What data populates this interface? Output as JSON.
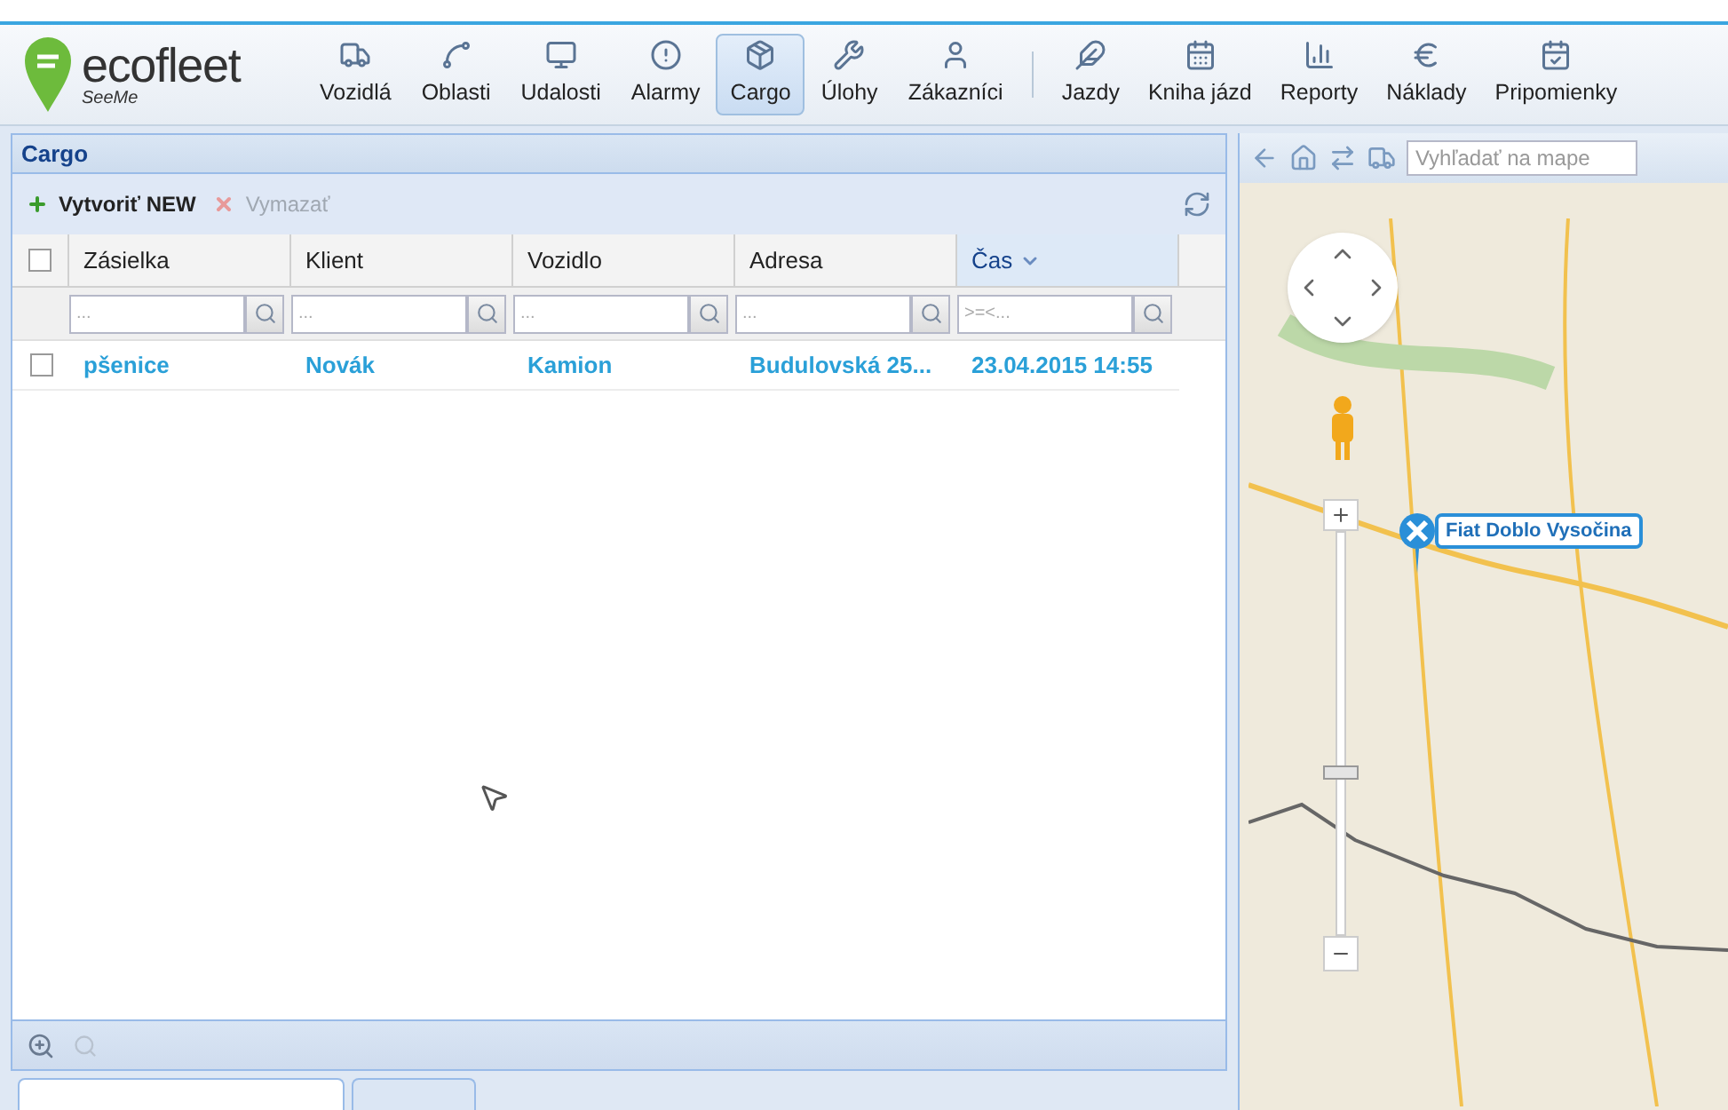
{
  "logo": {
    "name": "ecofleet",
    "subtitle": "SeeMe"
  },
  "nav_primary": [
    {
      "label": "Vozidlá",
      "selected": false
    },
    {
      "label": "Oblasti",
      "selected": false
    },
    {
      "label": "Udalosti",
      "selected": false
    },
    {
      "label": "Alarmy",
      "selected": false
    },
    {
      "label": "Cargo",
      "selected": true
    },
    {
      "label": "Úlohy",
      "selected": false
    },
    {
      "label": "Zákazníci",
      "selected": false
    }
  ],
  "nav_secondary": [
    {
      "label": "Jazdy",
      "selected": false
    },
    {
      "label": "Kniha jázd",
      "selected": false
    },
    {
      "label": "Reporty",
      "selected": false
    },
    {
      "label": "Náklady",
      "selected": false
    },
    {
      "label": "Pripomienky",
      "selected": false
    }
  ],
  "panel": {
    "title": "Cargo",
    "toolbar": [
      {
        "kind": "add",
        "label": "Vytvoriť NEW",
        "disabled": false
      },
      {
        "kind": "delete",
        "label": "Vymazať",
        "disabled": true
      }
    ],
    "table": {
      "select_all_checked": false,
      "columns": [
        {
          "label": "Zásielka",
          "sorted": false,
          "filter_placeholder": "..."
        },
        {
          "label": "Klient",
          "sorted": false,
          "filter_placeholder": "..."
        },
        {
          "label": "Vozidlo",
          "sorted": false,
          "filter_placeholder": "..."
        },
        {
          "label": "Adresa",
          "sorted": false,
          "filter_placeholder": "..."
        },
        {
          "label": "Čas",
          "sorted": true,
          "filter_placeholder": ">=<..."
        }
      ],
      "rows": [
        {
          "checked": false,
          "cells": [
            "pšenice",
            "Novák",
            "Kamion",
            "Budulovská 25...",
            "23.04.2015 14:55"
          ]
        }
      ]
    },
    "bottom_tabs": [
      {
        "selected": true
      },
      {
        "selected": false
      }
    ]
  },
  "map": {
    "search_placeholder": "Vyhľadať na mape",
    "zoom": {
      "level": 0.4
    },
    "marker": {
      "label": "Fiat Doblo Vysočina"
    }
  }
}
